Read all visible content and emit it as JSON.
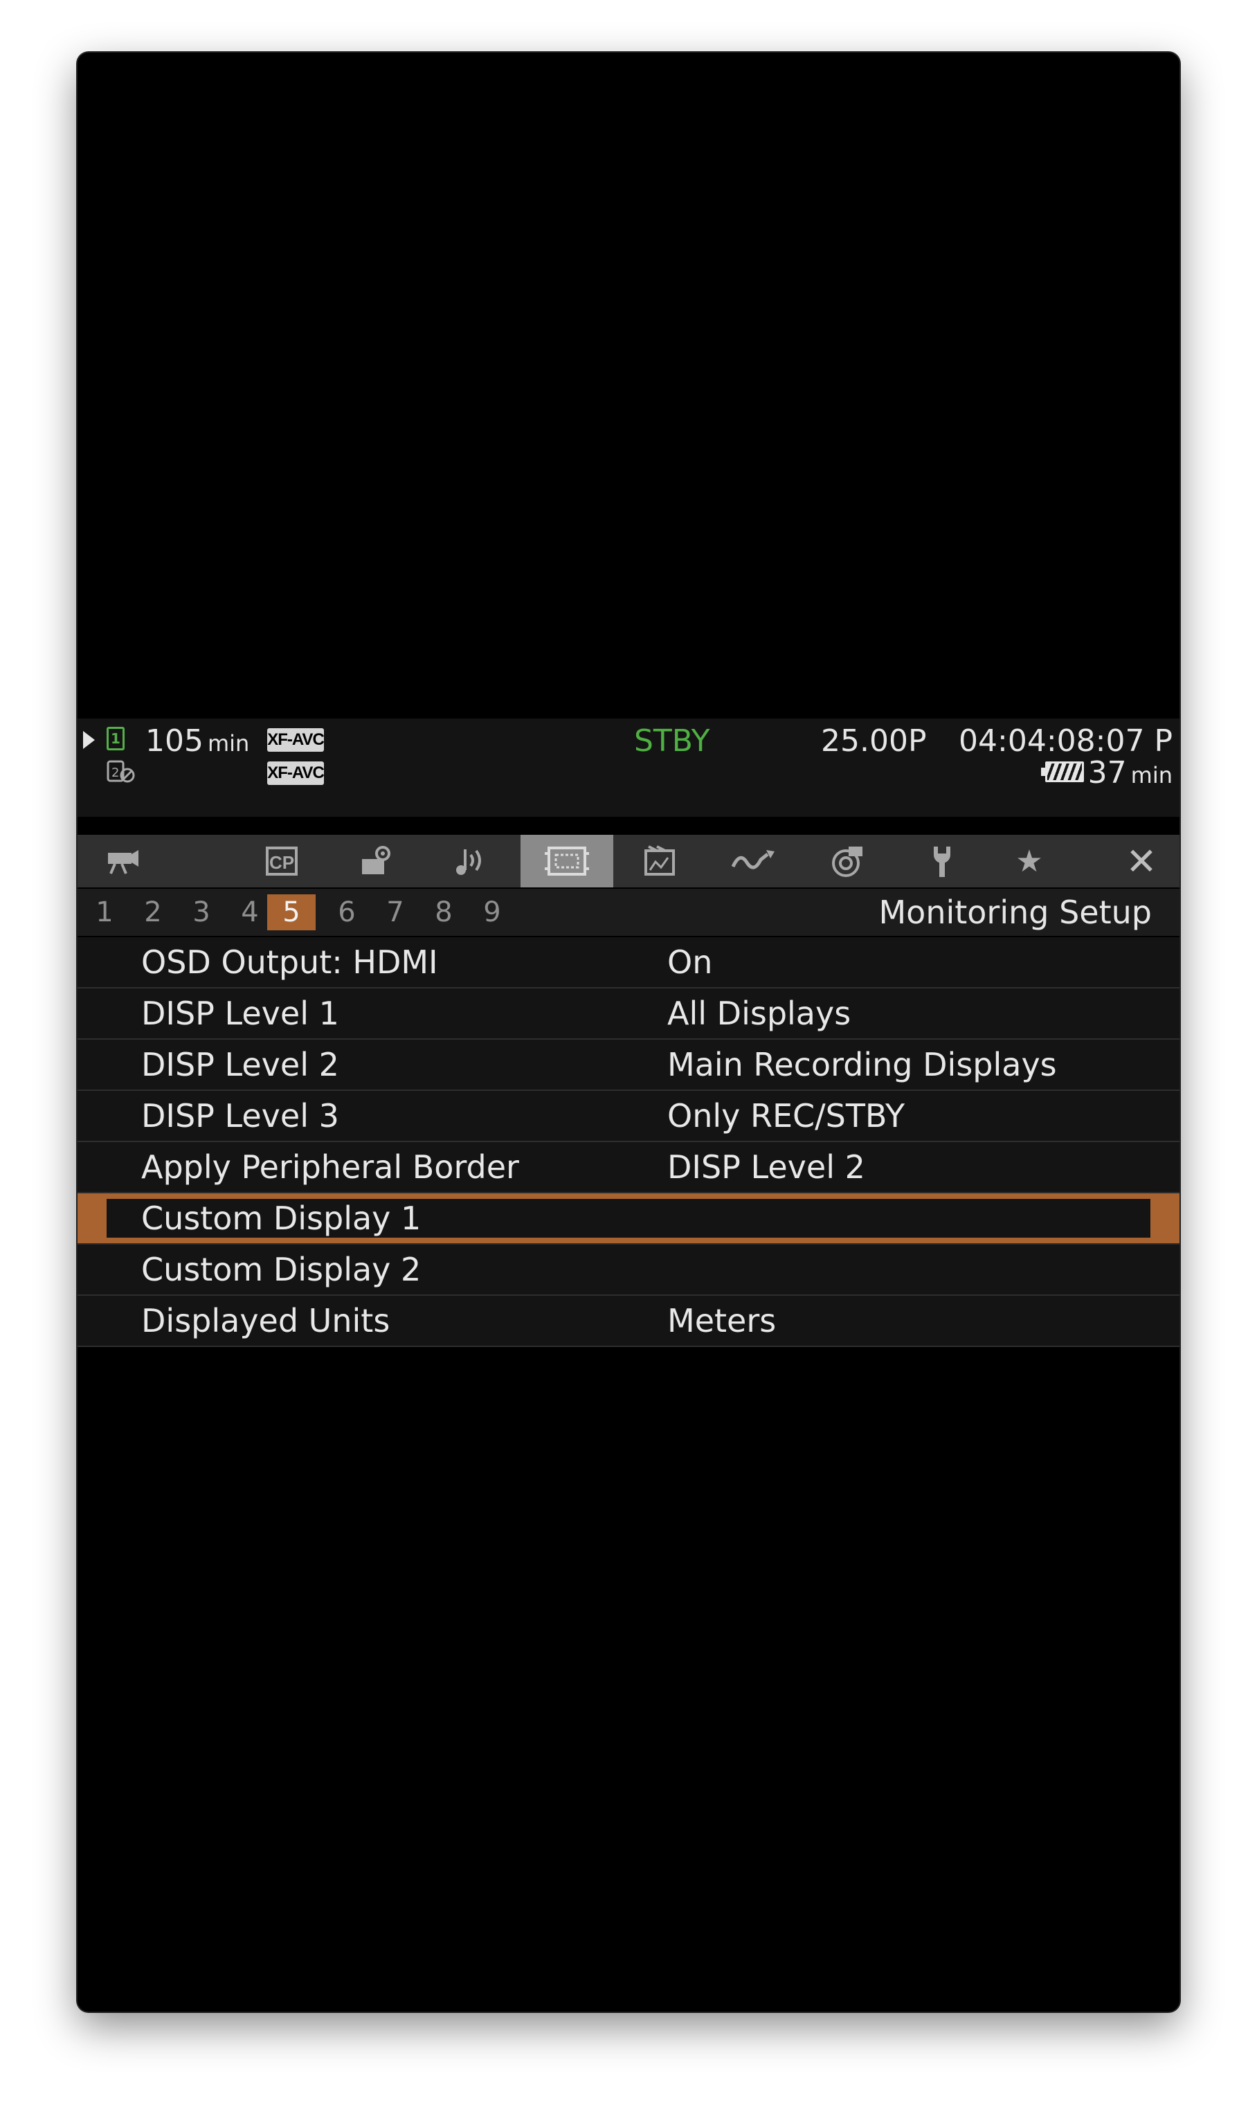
{
  "status": {
    "media1_minutes": "105",
    "media_unit": "min",
    "format1": "XF-AVC",
    "format2": "XF-AVC",
    "state": "STBY",
    "frame_rate": "25.00P",
    "timecode": "04:04:08:07 P",
    "battery_minutes": "37",
    "battery_unit": "min",
    "colors": {
      "state": "#4fb043",
      "media_active": "#55b04a"
    }
  },
  "tabs": [
    {
      "icon": "camera-icon"
    },
    {
      "icon": "custom-picture-icon",
      "label": "CP"
    },
    {
      "icon": "system-setup-icon"
    },
    {
      "icon": "audio-icon"
    },
    {
      "icon": "monitoring-icon",
      "active": true
    },
    {
      "icon": "recording-media-icon"
    },
    {
      "icon": "waveform-icon"
    },
    {
      "icon": "assist-functions-icon"
    },
    {
      "icon": "wrench-icon"
    },
    {
      "icon": "star-icon",
      "label": "★"
    },
    {
      "icon": "close-icon",
      "label": "✕"
    }
  ],
  "pages": {
    "numbers": [
      "1",
      "2",
      "3",
      "4",
      "5",
      "6",
      "7",
      "8",
      "9"
    ],
    "active": "5",
    "title": "Monitoring Setup"
  },
  "menu": [
    {
      "label": "OSD Output: HDMI",
      "value": "On"
    },
    {
      "label": "DISP Level 1",
      "value": "All Displays"
    },
    {
      "label": "DISP Level 2",
      "value": "Main Recording Displays"
    },
    {
      "label": "DISP Level 3",
      "value": "Only REC/STBY"
    },
    {
      "label": "Apply Peripheral Border",
      "value": "DISP Level 2"
    },
    {
      "label": "Custom Display 1",
      "value": "",
      "selected": true
    },
    {
      "label": "Custom Display 2",
      "value": ""
    },
    {
      "label": "Displayed Units",
      "value": "Meters"
    }
  ],
  "accent_color": "#a96330"
}
